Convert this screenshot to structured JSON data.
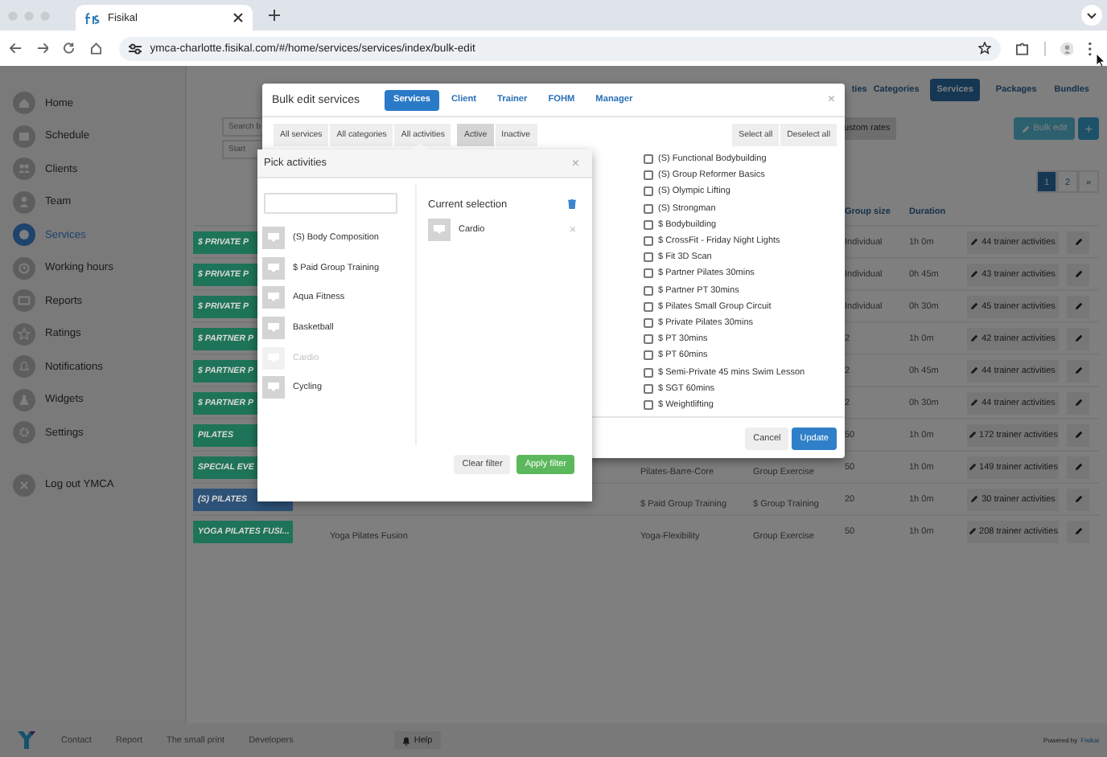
{
  "browser": {
    "tab_title": "Fisikal",
    "url": "ymca-charlotte.fisikal.com/#/home/services/services/index/bulk-edit"
  },
  "sidebar": {
    "items": [
      {
        "label": "Home",
        "selected": false
      },
      {
        "label": "Schedule",
        "selected": false
      },
      {
        "label": "Clients",
        "selected": false
      },
      {
        "label": "Team",
        "selected": false
      },
      {
        "label": "Services",
        "selected": true
      },
      {
        "label": "Working hours",
        "selected": false
      },
      {
        "label": "Reports",
        "selected": false
      },
      {
        "label": "Ratings",
        "selected": false
      },
      {
        "label": "Notifications",
        "selected": false
      },
      {
        "label": "Widgets",
        "selected": false
      },
      {
        "label": "Settings",
        "selected": false
      }
    ],
    "logout": "Log out YMCA"
  },
  "top_nav": [
    {
      "label": "ties",
      "selected": false
    },
    {
      "label": "Categories",
      "selected": false
    },
    {
      "label": "Services",
      "selected": true
    },
    {
      "label": "Packages",
      "selected": false
    },
    {
      "label": "Bundles",
      "selected": false
    }
  ],
  "toolbar": {
    "search_placeholder": "Search b",
    "date_placeholder": "Start",
    "custom_rates": "ustom rates",
    "bulk_edit": "Bulk edit",
    "add": "+"
  },
  "pagination": [
    {
      "label": "1",
      "selected": true
    },
    {
      "label": "2",
      "selected": false
    },
    {
      "label": "»",
      "selected": false
    }
  ],
  "table": {
    "columns": [
      "Group size",
      "Duration"
    ],
    "rows": [
      {
        "badge": "$ PRIVATE P",
        "color": "#1e7458",
        "group_size": "Individual",
        "duration": "1h 0m",
        "trainer_activities": "44 trainer activities"
      },
      {
        "badge": "$ PRIVATE P",
        "color": "#1e7458",
        "group_size": "Individual",
        "duration": "0h 45m",
        "trainer_activities": "43 trainer activities"
      },
      {
        "badge": "$ PRIVATE P",
        "color": "#1e7458",
        "group_size": "Individual",
        "duration": "0h 30m",
        "trainer_activities": "45 trainer activities"
      },
      {
        "badge": "$ PARTNER P",
        "color": "#1e7458",
        "group_size": "2",
        "duration": "1h 0m",
        "trainer_activities": "42 trainer activities"
      },
      {
        "badge": "$ PARTNER P",
        "color": "#1e7458",
        "group_size": "2",
        "duration": "0h 45m",
        "trainer_activities": "44 trainer activities"
      },
      {
        "badge": "$ PARTNER P",
        "color": "#1e7458",
        "group_size": "2",
        "duration": "0h 30m",
        "trainer_activities": "44 trainer activities"
      },
      {
        "badge": "PILATES",
        "color": "#1e7458",
        "group_size": "50",
        "duration": "1h 0m",
        "trainer_activities": "172 trainer activities"
      },
      {
        "badge": "SPECIAL EVE",
        "color": "#1e7458",
        "activity": "Pilates-Barre-Core",
        "category": "Group Exercise",
        "group_size": "50",
        "duration": "1h 0m",
        "trainer_activities": "149 trainer activities"
      },
      {
        "badge": "(S) PILATES",
        "color": "#2d5278",
        "activity": "$ Paid Group Training",
        "category": "$ Group Training",
        "group_size": "20",
        "duration": "1h 0m",
        "trainer_activities": "30 trainer activities"
      },
      {
        "badge": "YOGA PILATES FUSI...",
        "color": "#1e7458",
        "name": "Yoga Pilates Fusion",
        "activity": "Yoga-Flexibility",
        "category": "Group Exercise",
        "group_size": "50",
        "duration": "1h 0m",
        "trainer_activities": "208 trainer activities"
      }
    ]
  },
  "footer": {
    "links": [
      "Contact",
      "Report",
      "The small print",
      "Developers"
    ],
    "help": "Help",
    "powered_by": "Powered by",
    "brand": "Fisikal"
  },
  "bulk_edit": {
    "title": "Bulk edit services",
    "tabs": [
      {
        "label": "Services",
        "selected": true
      },
      {
        "label": "Client",
        "selected": false
      },
      {
        "label": "Trainer",
        "selected": false
      },
      {
        "label": "FOHM",
        "selected": false
      },
      {
        "label": "Manager",
        "selected": false
      }
    ],
    "close": "×",
    "filters": [
      {
        "label": "All services",
        "selected": false
      },
      {
        "label": "All categories",
        "selected": false
      },
      {
        "label": "All activities",
        "selected": false
      }
    ],
    "status_filters": [
      {
        "label": "Active",
        "selected": true
      },
      {
        "label": "Inactive",
        "selected": false
      }
    ],
    "select_all": "Select all",
    "deselect_all": "Deselect all",
    "services": [
      {
        "label": "(S) Functional Bodybuilding",
        "checked": false
      },
      {
        "label": "(S) Group Reformer Basics",
        "checked": false
      },
      {
        "label": "(S) Olympic Lifting",
        "checked": false
      },
      {
        "label": "(S) Strongman",
        "checked": false
      },
      {
        "label": "$ Bodybuilding",
        "checked": false
      },
      {
        "label": "$ CrossFit - Friday Night Lights",
        "checked": false
      },
      {
        "label": "$ Fit 3D Scan",
        "checked": false
      },
      {
        "label": "$ Partner Pilates 30mins",
        "checked": false
      },
      {
        "label": "$ Partner PT 30mins",
        "checked": false
      },
      {
        "label": "$ Pilates Small Group Circuit",
        "checked": false
      },
      {
        "label": "$ Private Pilates 30mins",
        "checked": false
      },
      {
        "label": "$ PT 30mins",
        "checked": false
      },
      {
        "label": "$ PT 60mins",
        "checked": false
      },
      {
        "label": "$ Semi-Private 45 mins Swim Lesson",
        "checked": false
      },
      {
        "label": "$ SGT 60mins",
        "checked": false
      },
      {
        "label": "$ Weightlifting",
        "checked": false
      }
    ],
    "cancel": "Cancel",
    "update": "Update"
  },
  "pick_activities": {
    "title": "Pick activities",
    "close": "×",
    "activities": [
      {
        "label": "(S) Body Composition",
        "selected": false
      },
      {
        "label": "$ Paid Group Training",
        "selected": false
      },
      {
        "label": "Aqua Fitness",
        "selected": false
      },
      {
        "label": "Basketball",
        "selected": false
      },
      {
        "label": "Cardio",
        "selected": true
      },
      {
        "label": "Cycling",
        "selected": false
      }
    ],
    "current_selection_title": "Current selection",
    "current_selection": [
      {
        "label": "Cardio",
        "remove": "×"
      }
    ],
    "clear": "Clear filter",
    "apply": "Apply filter"
  }
}
